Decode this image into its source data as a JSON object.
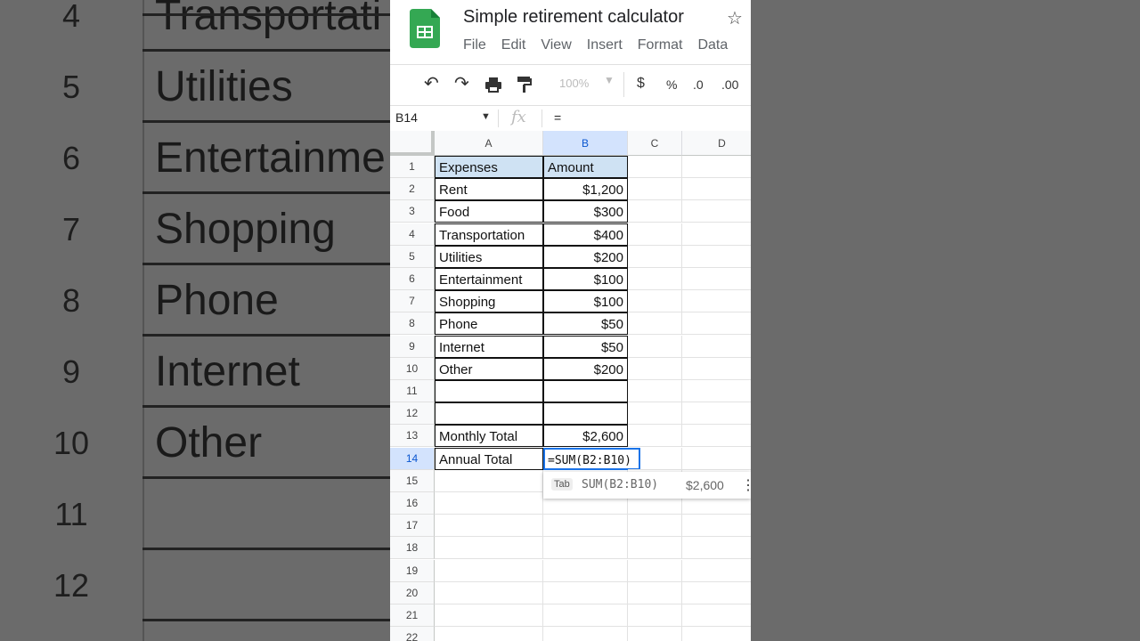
{
  "app": {
    "title": "Simple retirement calculator",
    "menu": [
      "File",
      "Edit",
      "View",
      "Insert",
      "Format",
      "Data"
    ],
    "colors": {
      "brand_green": "#34a853",
      "selection_blue": "#1a73e8",
      "header_fill": "#cfe2f3"
    }
  },
  "toolbar": {
    "zoom": "100%",
    "currency": "$",
    "percent": "%",
    "decrease_decimal": ".0",
    "increase_decimal": ".00"
  },
  "formula_bar": {
    "name_box": "B14",
    "fx": "fx",
    "content": "="
  },
  "columns": [
    "A",
    "B",
    "C",
    "D"
  ],
  "rows": [
    {
      "num": "1",
      "a": "Expenses",
      "b": "Amount"
    },
    {
      "num": "2",
      "a": "Rent",
      "b": "$1,200"
    },
    {
      "num": "3",
      "a": "Food",
      "b": "$300"
    },
    {
      "num": "4",
      "a": "Transportation",
      "b": "$400"
    },
    {
      "num": "5",
      "a": "Utilities",
      "b": "$200"
    },
    {
      "num": "6",
      "a": "Entertainment",
      "b": "$100"
    },
    {
      "num": "7",
      "a": "Shopping",
      "b": "$100"
    },
    {
      "num": "8",
      "a": "Phone",
      "b": "$50"
    },
    {
      "num": "9",
      "a": "Internet",
      "b": "$50"
    },
    {
      "num": "10",
      "a": "Other",
      "b": "$200"
    },
    {
      "num": "11",
      "a": "",
      "b": ""
    },
    {
      "num": "12",
      "a": "",
      "b": ""
    },
    {
      "num": "13",
      "a": "Monthly Total",
      "b": "$2,600"
    },
    {
      "num": "14",
      "a": "Annual Total",
      "b": "=SUM(B2:B10)"
    },
    {
      "num": "15",
      "a": "",
      "b": ""
    },
    {
      "num": "16",
      "a": "",
      "b": ""
    },
    {
      "num": "17",
      "a": "",
      "b": ""
    },
    {
      "num": "18",
      "a": "",
      "b": ""
    },
    {
      "num": "19",
      "a": "",
      "b": ""
    },
    {
      "num": "20",
      "a": "",
      "b": ""
    },
    {
      "num": "21",
      "a": "",
      "b": ""
    },
    {
      "num": "22",
      "a": "",
      "b": ""
    }
  ],
  "suggestion": {
    "key": "Tab",
    "formula": "SUM(B2:B10)",
    "preview": "$2,600"
  },
  "background_zoom": [
    {
      "num": "4",
      "text": "Transportati"
    },
    {
      "num": "5",
      "text": "Utilities"
    },
    {
      "num": "6",
      "text": "Entertainme"
    },
    {
      "num": "7",
      "text": "Shopping"
    },
    {
      "num": "8",
      "text": "Phone"
    },
    {
      "num": "9",
      "text": "Internet"
    },
    {
      "num": "10",
      "text": "Other"
    },
    {
      "num": "11",
      "text": ""
    },
    {
      "num": "12",
      "text": ""
    }
  ]
}
